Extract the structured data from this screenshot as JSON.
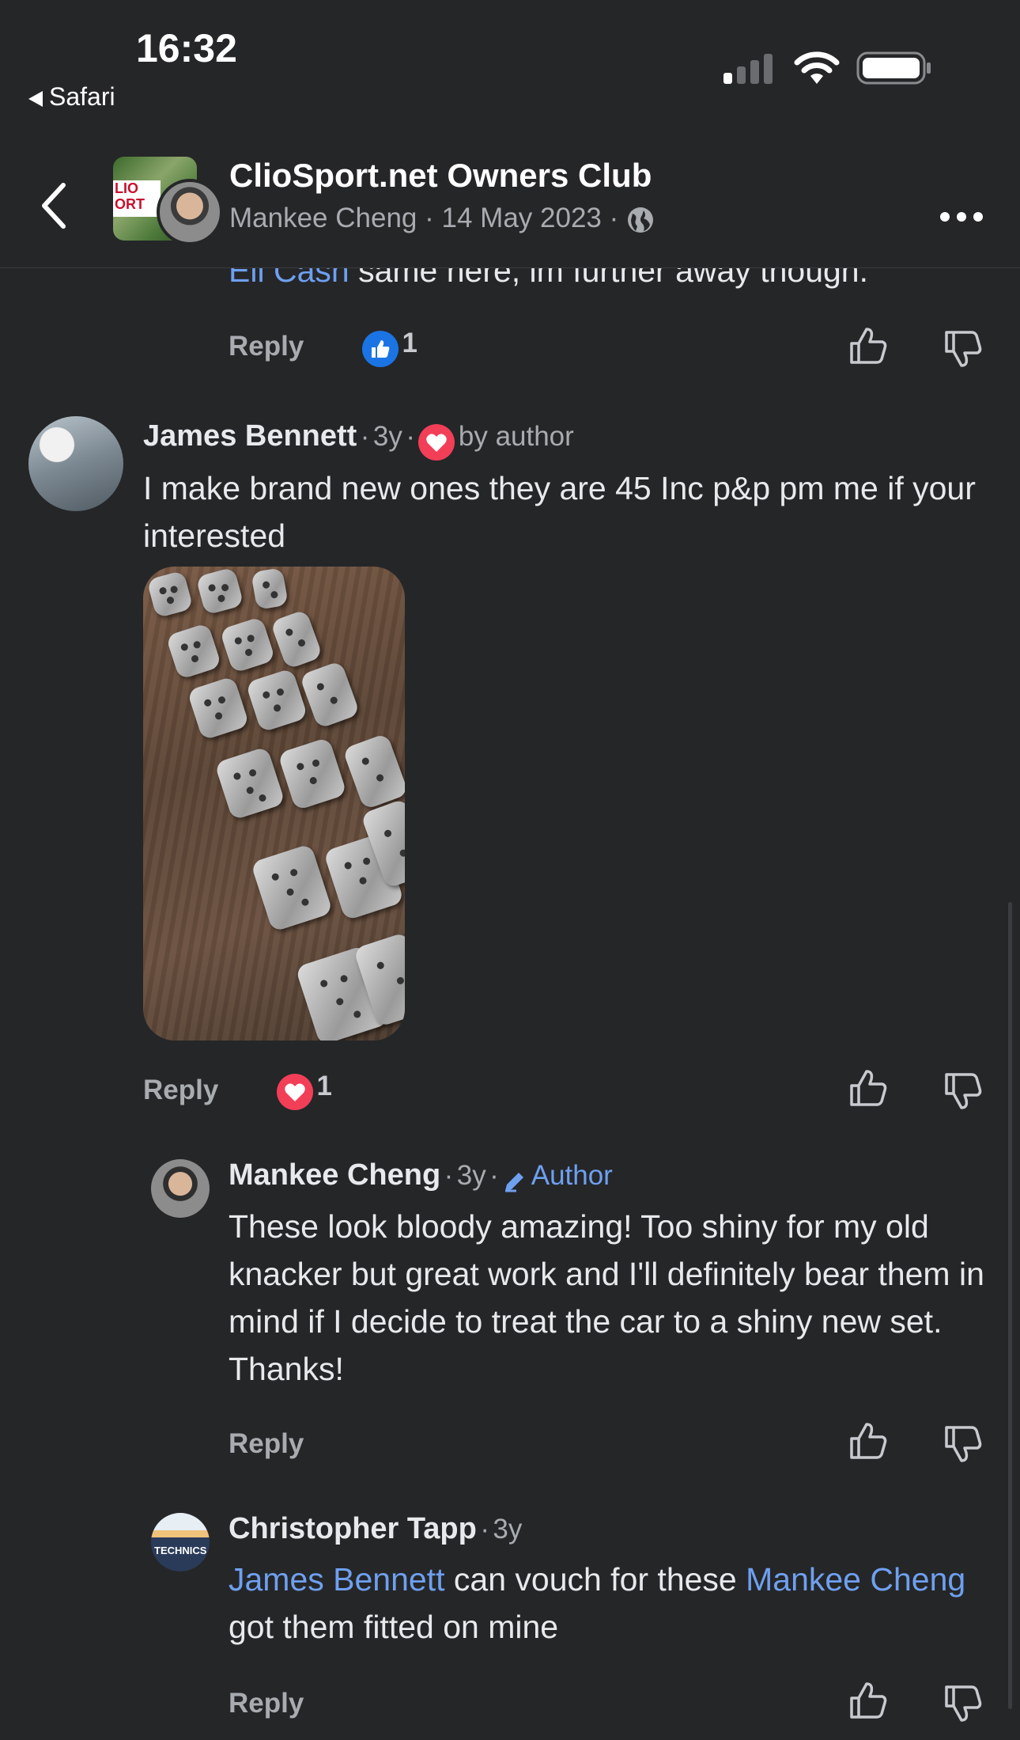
{
  "status_bar": {
    "time": "16:32",
    "back_app": "Safari"
  },
  "header": {
    "group_name": "ClioSport.net Owners Club",
    "author": "Mankee Cheng",
    "date": "14 May 2023",
    "separator": "·"
  },
  "comments": {
    "prev": {
      "mention": "Eli Cash",
      "text": " same here, im further away though.",
      "reply_label": "Reply",
      "reaction_count": "1"
    },
    "c1": {
      "name": "James Bennett",
      "time": "3y",
      "badge": "by author",
      "text": "I make brand new ones they are 45 Inc p&p pm me if your interested",
      "reply_label": "Reply",
      "reaction_count": "1"
    },
    "c2": {
      "name": "Mankee Cheng",
      "time": "3y",
      "badge": "Author",
      "text": "These look bloody amazing! Too shiny for my old knacker but great work and I'll definitely bear them in mind if I decide to treat the car to a shiny new set. Thanks!",
      "reply_label": "Reply"
    },
    "c3": {
      "name": "Christopher Tapp",
      "time": "3y",
      "mention1": "James Bennett",
      "text1": " can vouch for these ",
      "mention2": "Mankee Cheng",
      "text2": " got them fitted on mine",
      "reply_label": "Reply",
      "avatar_text": "TECHNICS"
    }
  },
  "icons": {
    "back": "chevron-left-icon",
    "more": "more-horizontal-icon",
    "globe": "globe-icon",
    "like": "thumbs-up-icon",
    "dislike": "thumbs-down-icon",
    "heart": "heart-icon",
    "pencil": "pencil-icon"
  },
  "colors": {
    "background": "#252628",
    "mention": "#6ea0f0",
    "heart": "#f33e58",
    "like": "#1b74e4"
  }
}
